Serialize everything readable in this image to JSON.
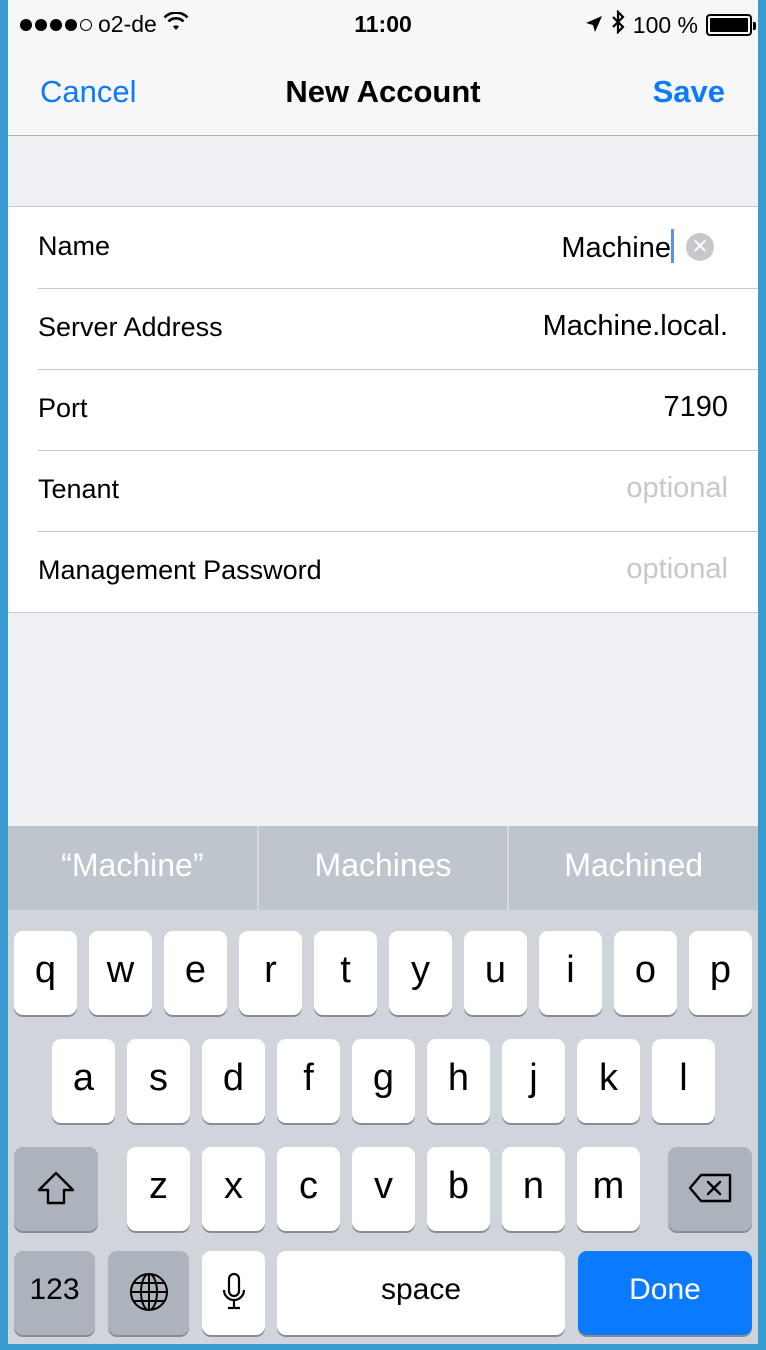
{
  "status_bar": {
    "carrier": "o2-de",
    "time": "11:00",
    "battery": "100 %"
  },
  "nav": {
    "cancel_label": "Cancel",
    "title": "New Account",
    "save_label": "Save"
  },
  "form": {
    "rows": [
      {
        "label": "Name",
        "value": "Machine"
      },
      {
        "label": "Server Address",
        "value": "Machine.local."
      },
      {
        "label": "Port",
        "value": "7190"
      },
      {
        "label": "Tenant",
        "placeholder": "optional"
      },
      {
        "label": "Management Password",
        "placeholder": "optional"
      }
    ]
  },
  "keyboard": {
    "suggestions": [
      "“Machine”",
      "Machines",
      "Machined"
    ],
    "row1": [
      "q",
      "w",
      "e",
      "r",
      "t",
      "y",
      "u",
      "i",
      "o",
      "p"
    ],
    "row2": [
      "a",
      "s",
      "d",
      "f",
      "g",
      "h",
      "j",
      "k",
      "l"
    ],
    "row3": [
      "z",
      "x",
      "c",
      "v",
      "b",
      "n",
      "m"
    ],
    "numbers_label": "123",
    "space_label": "space",
    "done_label": "Done"
  },
  "colors": {
    "accent": "#0a7aff",
    "frame": "#3a9bd1"
  }
}
